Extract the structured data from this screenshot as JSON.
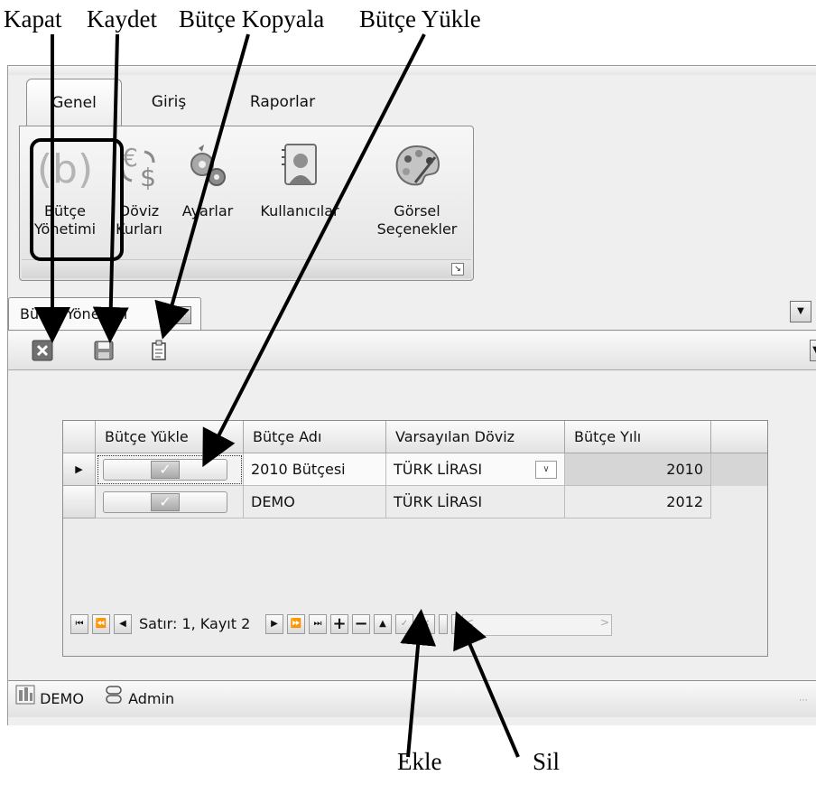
{
  "annotations": {
    "kapat": "Kapat",
    "kaydet": "Kaydet",
    "butce_kopyala": "Bütçe Kopyala",
    "butce_yukle": "Bütçe Yükle",
    "ekle": "Ekle",
    "sil": "Sil"
  },
  "ribbon_tabs": [
    "Genel",
    "Giriş",
    "Raporlar"
  ],
  "ribbon_buttons": [
    {
      "label1": "Bütçe",
      "label2": "Yönetimi",
      "icon": "budget-icon"
    },
    {
      "label1": "Döviz",
      "label2": "Kurları",
      "icon": "currency-exchange-icon"
    },
    {
      "label1": "Ayarlar",
      "label2": "",
      "icon": "settings-gears-icon"
    },
    {
      "label1": "Kullanıcılar",
      "label2": "",
      "icon": "users-icon"
    },
    {
      "label1": "Görsel",
      "label2": "Seçenekler",
      "icon": "palette-icon"
    }
  ],
  "document_tab": {
    "label": "Bütçe Yönetimi"
  },
  "toolbar": {
    "close_icon": "close-icon",
    "save_icon": "save-icon",
    "copy_icon": "copy-icon"
  },
  "grid": {
    "columns": [
      "Bütçe Yükle",
      "Bütçe Adı",
      "Varsayılan Döviz",
      "Bütçe Yılı"
    ],
    "rows": [
      {
        "name": "2010 Bütçesi",
        "currency": "TÜRK LİRASI",
        "year": "2010",
        "loaded": true
      },
      {
        "name": "DEMO",
        "currency": "TÜRK LİRASI",
        "year": "2012",
        "loaded": true
      }
    ]
  },
  "navigator": {
    "record_text": "Satır: 1, Kayıt 2"
  },
  "status_bar": {
    "database": "DEMO",
    "user": "Admin"
  }
}
